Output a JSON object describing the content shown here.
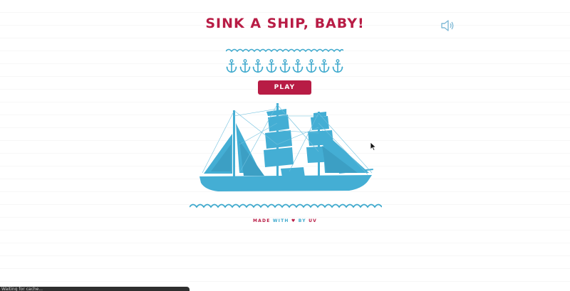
{
  "title": "SINK A SHIP, BABY!",
  "sound_icon": "speaker-icon",
  "anchors": {
    "count": 9,
    "icon": "anchor-icon"
  },
  "play_button": {
    "label": "PLAY"
  },
  "ship": {
    "icon": "tall-ship-icon"
  },
  "credit": {
    "made": "MADE",
    "with": "WITH",
    "heart": "♥",
    "by": "BY",
    "author": "UV"
  },
  "status_bar": {
    "text": "Waiting for cache..."
  },
  "colors": {
    "accent_red": "#b81c45",
    "ocean_blue": "#3ea9cd",
    "ship_blue": "#44aed4"
  }
}
